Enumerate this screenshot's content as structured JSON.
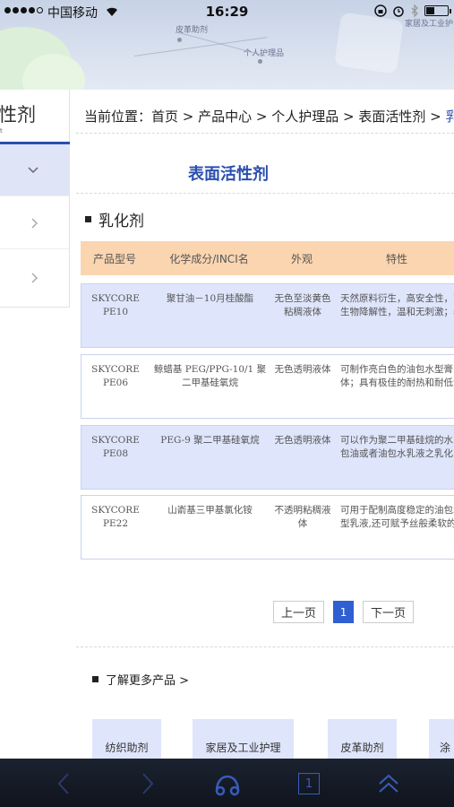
{
  "status_bar": {
    "carrier": "中国移动",
    "time": "16:29"
  },
  "banner": {
    "labels": [
      "皮革助剂",
      "个人护理品",
      "家居及工业护"
    ]
  },
  "sidebar": {
    "title": "性剂",
    "subtitle": "t"
  },
  "breadcrumb": {
    "prefix": "当前位置：",
    "home": "首页",
    "sep": " > ",
    "products": "产品中心",
    "personal_care": "个人护理品",
    "surfactants": "表面活性剂",
    "current": "乳化"
  },
  "page_title": "表面活性剂",
  "section_title": "乳化剂",
  "table": {
    "headers": [
      "产品型号",
      "化学成分/INCI名",
      "外观",
      "特性"
    ],
    "rows": [
      {
        "model": "SKYCORE PE10",
        "chem": "聚甘油－10月桂酸酯",
        "appearance": "无色至淡黄色粘稠液体",
        "features": [
          "天然原料衍生，高安全性，高",
          "生物降解性，温和无刺激；表"
        ]
      },
      {
        "model": "SKYCORE PE06",
        "chem": "鲸蜡基 PEG/PPG-10/1 聚二甲基硅氧烷",
        "appearance": "无色透明液体",
        "features": [
          "可制作亮白色的油包水型膏",
          "体；具有极佳的耐热和耐低温"
        ]
      },
      {
        "model": "SKYCORE PE08",
        "chem": "PEG-9 聚二甲基硅氧烷",
        "appearance": "无色透明液体",
        "features": [
          "可以作为聚二甲基硅烷的水",
          "包油或者油包水乳液之乳化"
        ]
      },
      {
        "model": "SKYCORE PE22",
        "chem": "山嵛基三甲基氯化铵",
        "appearance": "不透明粘稠液体",
        "features": [
          "可用于配制高度稳定的油包水",
          "型乳液,还可赋予丝般柔软的"
        ]
      }
    ]
  },
  "pager": {
    "prev": "上一页",
    "current": "1",
    "next": "下一页"
  },
  "more": {
    "title": "了解更多产品 >",
    "cards": [
      "纺织助剂",
      "家居及工业护理",
      "皮革助剂",
      "涂"
    ]
  },
  "toolbar": {
    "tab_count": "1"
  }
}
